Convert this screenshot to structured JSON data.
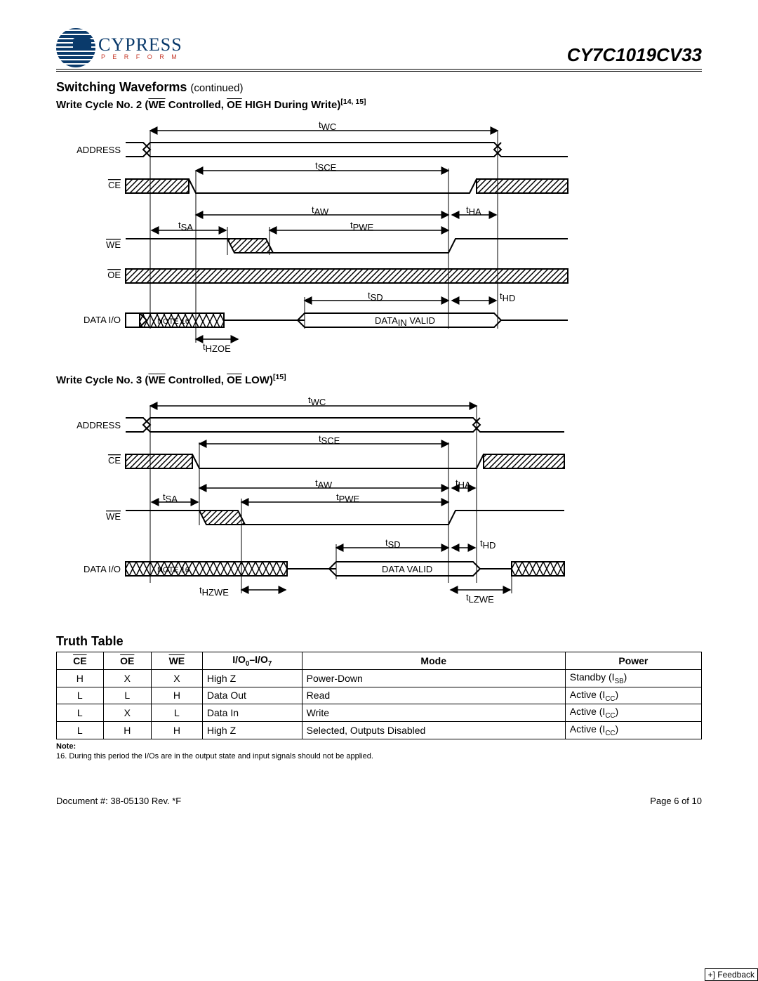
{
  "header": {
    "brand": "CYPRESS",
    "tagline": "P E R F O R M",
    "part_number": "CY7C1019CV33"
  },
  "section": {
    "title": "Switching Waveforms",
    "continued": "(continued)"
  },
  "diagram2": {
    "title_pre": "Write Cycle No. 2 (",
    "title_we": "WE",
    "title_mid": " Controlled, ",
    "title_oe": "OE",
    "title_post": " HIGH During Write)",
    "title_refs": "[14, 15]",
    "signals": {
      "address": "ADDRESS",
      "ce": "CE",
      "we": "WE",
      "oe": "OE",
      "dio": "DATA I/O"
    },
    "timings": {
      "twc": "t",
      "twc_sub": "WC",
      "tsce": "t",
      "tsce_sub": "SCE",
      "taw": "t",
      "taw_sub": "AW",
      "tha": "t",
      "tha_sub": "HA",
      "tsa": "t",
      "tsa_sub": "SA",
      "tpwe": "t",
      "tpwe_sub": "PWE",
      "tsd": "t",
      "tsd_sub": "SD",
      "thd": "t",
      "thd_sub": "HD",
      "thzoe": "t",
      "thzoe_sub": "HZOE"
    },
    "note16": "NOTE 16",
    "datain": "DATA",
    "datain_sub": "IN",
    "datain_post": " VALID"
  },
  "diagram3": {
    "title_pre": "Write Cycle No. 3 (",
    "title_we": "WE",
    "title_mid": " Controlled, ",
    "title_oe": "OE",
    "title_post": " LOW)",
    "title_refs": "[15]",
    "signals": {
      "address": "ADDRESS",
      "ce": "CE",
      "we": "WE",
      "dio": "DATA  I/O"
    },
    "timings": {
      "twc": "t",
      "twc_sub": "WC",
      "tsce": "t",
      "tsce_sub": "SCE",
      "taw": "t",
      "taw_sub": "AW",
      "tha": "t",
      "tha_sub": "HA",
      "tsa": "t",
      "tsa_sub": "SA",
      "tpwe": "t",
      "tpwe_sub": "PWE",
      "tsd": "t",
      "tsd_sub": "SD",
      "thd": "t",
      "thd_sub": "HD",
      "thzwe": "t",
      "thzwe_sub": "HZWE",
      "tlzwe": "t",
      "tlzwe_sub": "LZWE"
    },
    "note16": "NOTE 16",
    "datavalid": "DATA VALID"
  },
  "truth_table": {
    "title": "Truth Table",
    "headers": {
      "ce": "CE",
      "oe": "OE",
      "we": "WE",
      "io_pre": "I/O",
      "io_sub0": "0",
      "io_mid": "–I/O",
      "io_sub7": "7",
      "mode": "Mode",
      "power": "Power"
    },
    "rows": [
      {
        "ce": "H",
        "oe": "X",
        "we": "X",
        "io": "High Z",
        "mode": "Power-Down",
        "power_pre": "Standby (I",
        "power_sub": "SB",
        "power_post": ")"
      },
      {
        "ce": "L",
        "oe": "L",
        "we": "H",
        "io": "Data Out",
        "mode": "Read",
        "power_pre": "Active (I",
        "power_sub": "CC",
        "power_post": ")"
      },
      {
        "ce": "L",
        "oe": "X",
        "we": "L",
        "io": "Data In",
        "mode": "Write",
        "power_pre": "Active (I",
        "power_sub": "CC",
        "power_post": ")"
      },
      {
        "ce": "L",
        "oe": "H",
        "we": "H",
        "io": "High Z",
        "mode": "Selected, Outputs Disabled",
        "power_pre": "Active (I",
        "power_sub": "CC",
        "power_post": ")"
      }
    ]
  },
  "note": {
    "head": "Note:",
    "text": "16. During this period the I/Os are in the output state and input signals should not be applied."
  },
  "footer": {
    "doc": "Document #: 38-05130  Rev. *F",
    "page": "Page 6 of 10",
    "feedback": "+] Feedback"
  }
}
